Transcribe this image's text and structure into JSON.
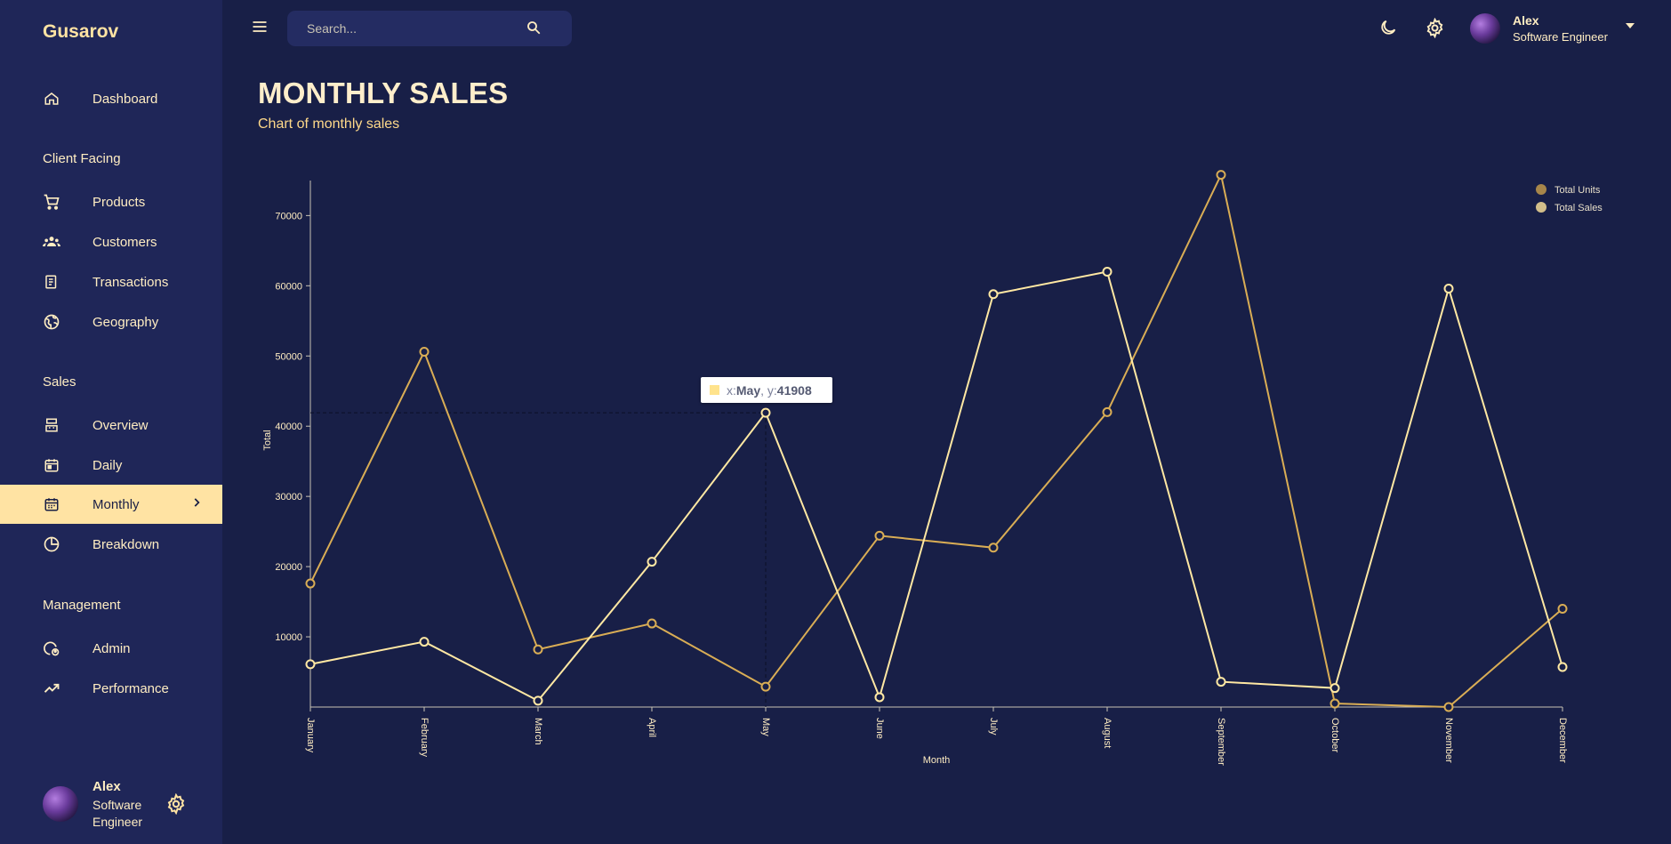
{
  "app": {
    "brand": "Gusarov"
  },
  "sidebar": {
    "items": [
      {
        "label": "Dashboard",
        "icon": "home-icon"
      },
      {
        "section": "Client Facing"
      },
      {
        "label": "Products",
        "icon": "cart-icon"
      },
      {
        "label": "Customers",
        "icon": "groups-icon"
      },
      {
        "label": "Transactions",
        "icon": "receipt-icon"
      },
      {
        "label": "Geography",
        "icon": "globe-icon"
      },
      {
        "section": "Sales"
      },
      {
        "label": "Overview",
        "icon": "point-of-sale-icon"
      },
      {
        "label": "Daily",
        "icon": "calendar-icon"
      },
      {
        "label": "Monthly",
        "icon": "calendar-month-icon",
        "active": true
      },
      {
        "label": "Breakdown",
        "icon": "pie-chart-icon"
      },
      {
        "section": "Management"
      },
      {
        "label": "Admin",
        "icon": "admin-icon"
      },
      {
        "label": "Performance",
        "icon": "trending-up-icon"
      }
    ],
    "user": {
      "name": "Alex",
      "role": "Software Engineer"
    }
  },
  "topbar": {
    "search_placeholder": "Search...",
    "user": {
      "name": "Alex",
      "role": "Software Engineer"
    }
  },
  "header": {
    "title": "MONTHLY SALES",
    "subtitle": "Chart of monthly sales"
  },
  "tooltip": {
    "x_label": "x: ",
    "x_value": "May",
    "sep": ", y: ",
    "y_value": "41908"
  },
  "colors": {
    "background": "#181f47",
    "sidebar": "#1f2658",
    "accent": "#ffe3a3",
    "units_line": "#d9ad55",
    "sales_line": "#ffe8a3"
  },
  "chart_data": {
    "type": "line",
    "xlabel": "Month",
    "ylabel": "Total",
    "x": [
      "January",
      "February",
      "March",
      "April",
      "May",
      "June",
      "July",
      "August",
      "September",
      "October",
      "November",
      "December"
    ],
    "ylim": [
      0,
      76000
    ],
    "yticks": [
      10000,
      20000,
      30000,
      40000,
      50000,
      60000,
      70000
    ],
    "legend_position": "top-right",
    "series": [
      {
        "name": "Total Units",
        "color": "#d9ad55",
        "values": [
          17600,
          50600,
          8200,
          11900,
          2900,
          24400,
          22700,
          42000,
          75800,
          500,
          0,
          14000
        ]
      },
      {
        "name": "Total Sales",
        "color": "#ffe8a3",
        "values": [
          6100,
          9300,
          900,
          20700,
          41908,
          1400,
          58800,
          62000,
          3600,
          2700,
          59600,
          5700
        ]
      }
    ]
  }
}
